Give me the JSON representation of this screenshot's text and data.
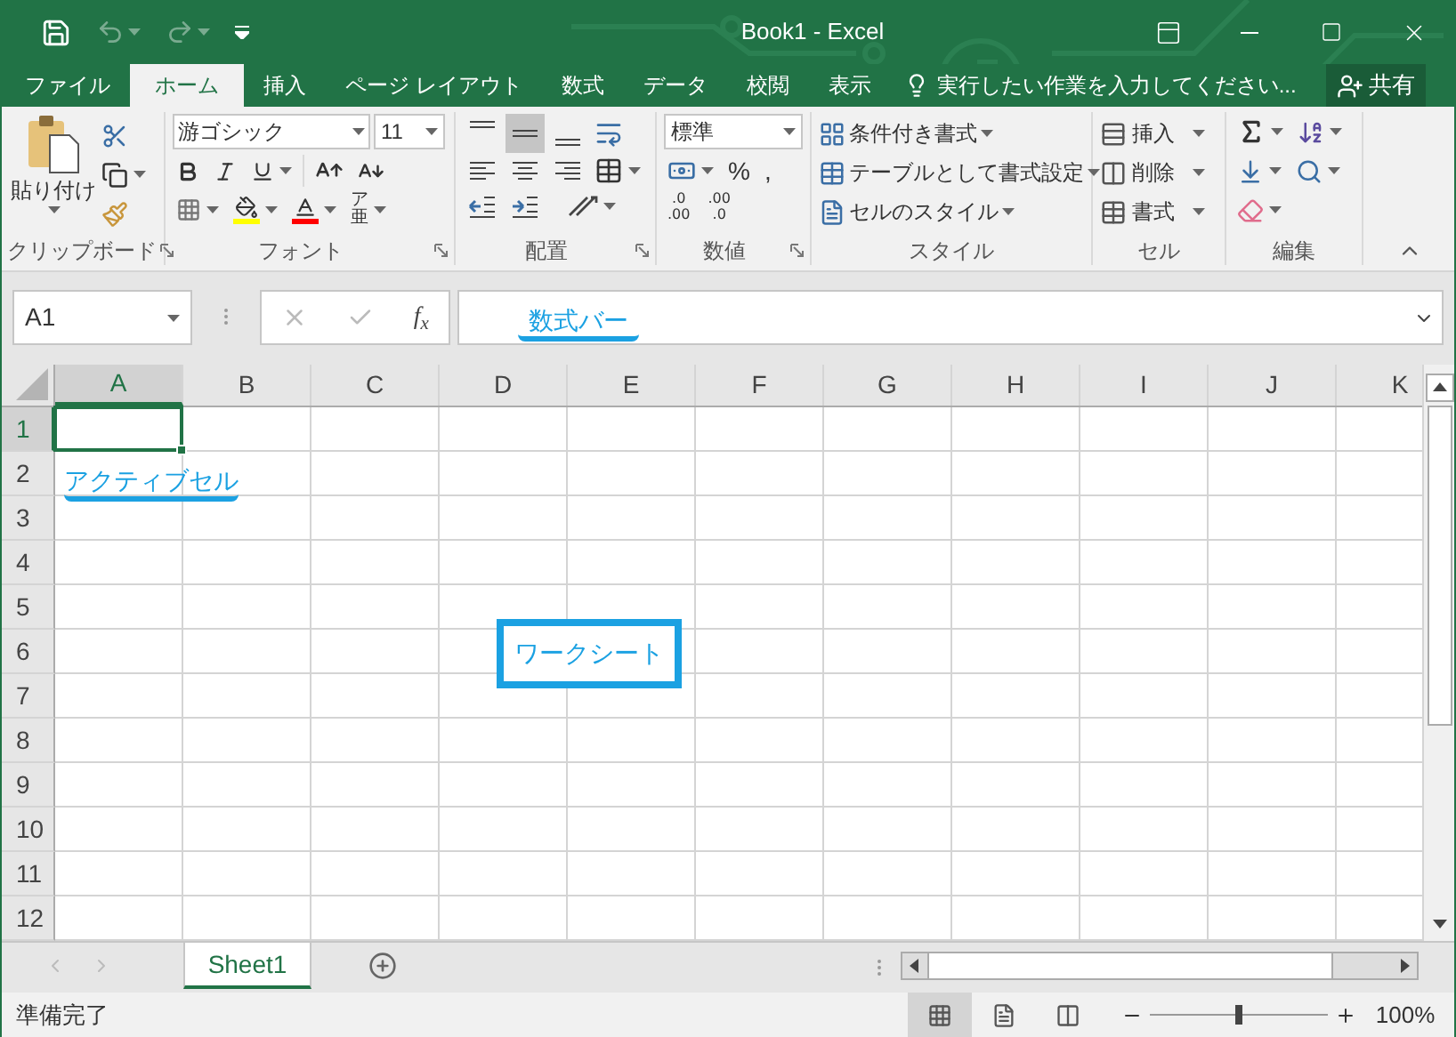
{
  "title_bar": {
    "title": "Book1 - Excel"
  },
  "tabs": [
    {
      "label": "ファイル",
      "selected": false
    },
    {
      "label": "ホーム",
      "selected": true
    },
    {
      "label": "挿入",
      "selected": false
    },
    {
      "label": "ページ レイアウト",
      "selected": false
    },
    {
      "label": "数式",
      "selected": false
    },
    {
      "label": "データ",
      "selected": false
    },
    {
      "label": "校閲",
      "selected": false
    },
    {
      "label": "表示",
      "selected": false
    }
  ],
  "tell_me": "実行したい作業を入力してください...",
  "share_button": "共有",
  "ribbon": {
    "clipboard": {
      "paste": "貼り付け",
      "label": "クリップボード"
    },
    "font": {
      "font_name": "游ゴシック",
      "font_size": "11",
      "phonetic": [
        "ア",
        "亜"
      ],
      "label": "フォント"
    },
    "alignment": {
      "vertical_align": [
        {
          "kind": "top",
          "selected": false
        },
        {
          "kind": "middle",
          "selected": true
        },
        {
          "kind": "bottom",
          "selected": false
        }
      ],
      "label": "配置"
    },
    "number": {
      "format": "標準",
      "symbols": [
        "%",
        ","
      ],
      "decimal_buttons": [
        [
          ".0",
          ".00"
        ],
        [
          ".00",
          ".0"
        ]
      ],
      "label": "数値"
    },
    "styles": {
      "commands": [
        "条件付き書式",
        "テーブルとして書式設定",
        "セルのスタイル"
      ],
      "label": "スタイル"
    },
    "cells": {
      "commands": [
        "挿入",
        "削除",
        "書式"
      ],
      "label": "セル"
    },
    "editing": {
      "label": "編集"
    }
  },
  "formula_bar": {
    "name_box": "A1",
    "function_label": "f$_{x}$",
    "callout": "数式バー"
  },
  "grid": {
    "columns": [
      {
        "label": "A",
        "selected": true
      },
      {
        "label": "B",
        "selected": false
      },
      {
        "label": "C",
        "selected": false
      },
      {
        "label": "D",
        "selected": false
      },
      {
        "label": "E",
        "selected": false
      },
      {
        "label": "F",
        "selected": false
      },
      {
        "label": "G",
        "selected": false
      },
      {
        "label": "H",
        "selected": false
      },
      {
        "label": "I",
        "selected": false
      },
      {
        "label": "J",
        "selected": false
      },
      {
        "label": "K",
        "selected": false
      }
    ],
    "rows": [
      {
        "label": "1",
        "selected": true
      },
      {
        "label": "2",
        "selected": false
      },
      {
        "label": "3",
        "selected": false
      },
      {
        "label": "4",
        "selected": false
      },
      {
        "label": "5",
        "selected": false
      },
      {
        "label": "6",
        "selected": false
      },
      {
        "label": "7",
        "selected": false
      },
      {
        "label": "8",
        "selected": false
      },
      {
        "label": "9",
        "selected": false
      },
      {
        "label": "10",
        "selected": false
      },
      {
        "label": "11",
        "selected": false
      },
      {
        "label": "12",
        "selected": false
      }
    ],
    "callouts": [
      {
        "kind": "underline",
        "text": "アクティブセル"
      },
      {
        "kind": "boxed",
        "text": "ワークシート"
      }
    ]
  },
  "sheet_tabs": [
    {
      "label": "Sheet1",
      "selected": true
    }
  ],
  "status_bar": {
    "status": "準備完了",
    "views": [
      {
        "kind": "normal",
        "selected": true
      },
      {
        "kind": "page_layout",
        "selected": false
      },
      {
        "kind": "page_break",
        "selected": false
      }
    ],
    "zoom_slider": {
      "level": 0.5
    },
    "zoom": "100%"
  }
}
